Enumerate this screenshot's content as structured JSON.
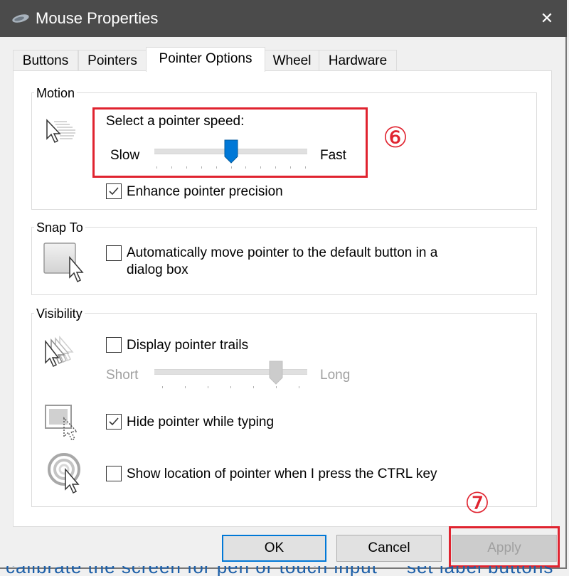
{
  "window": {
    "title": "Mouse Properties",
    "title_icon": "mouse-icon",
    "close_icon": "close-icon",
    "close_glyph": "✕"
  },
  "tabs": [
    {
      "label": "Buttons",
      "active": false
    },
    {
      "label": "Pointers",
      "active": false
    },
    {
      "label": "Pointer Options",
      "active": true
    },
    {
      "label": "Wheel",
      "active": false
    },
    {
      "label": "Hardware",
      "active": false
    }
  ],
  "motion": {
    "group_label": "Motion",
    "icon": "pointer-speed-icon",
    "speed_label": "Select a pointer speed:",
    "slow_label": "Slow",
    "fast_label": "Fast",
    "speed_value": 6,
    "speed_min": 1,
    "speed_max": 11,
    "enhance_precision_label": "Enhance pointer precision",
    "enhance_precision_checked": true
  },
  "snap_to": {
    "group_label": "Snap To",
    "icon": "snap-to-button-icon",
    "auto_move_label_line1": "Automatically move pointer to the default button in a",
    "auto_move_label_line2": "dialog box",
    "auto_move_checked": false
  },
  "visibility": {
    "group_label": "Visibility",
    "trails_icon": "pointer-trails-icon",
    "trails_label": "Display pointer trails",
    "trails_checked": false,
    "short_label": "Short",
    "long_label": "Long",
    "trails_length_value": 6,
    "trails_length_min": 1,
    "trails_length_max": 7,
    "hide_icon": "hide-pointer-icon",
    "hide_label": "Hide pointer while typing",
    "hide_checked": true,
    "ctrl_icon": "pointer-location-icon",
    "ctrl_label": "Show location of pointer when I press the CTRL key",
    "ctrl_checked": false
  },
  "buttons": {
    "ok": "OK",
    "cancel": "Cancel",
    "apply": "Apply"
  },
  "annotations": {
    "step6": "⑥",
    "step7": "⑦",
    "color": "#e0232f"
  },
  "colors": {
    "accent": "#0078d7",
    "titlebar": "#4b4b4b"
  }
}
